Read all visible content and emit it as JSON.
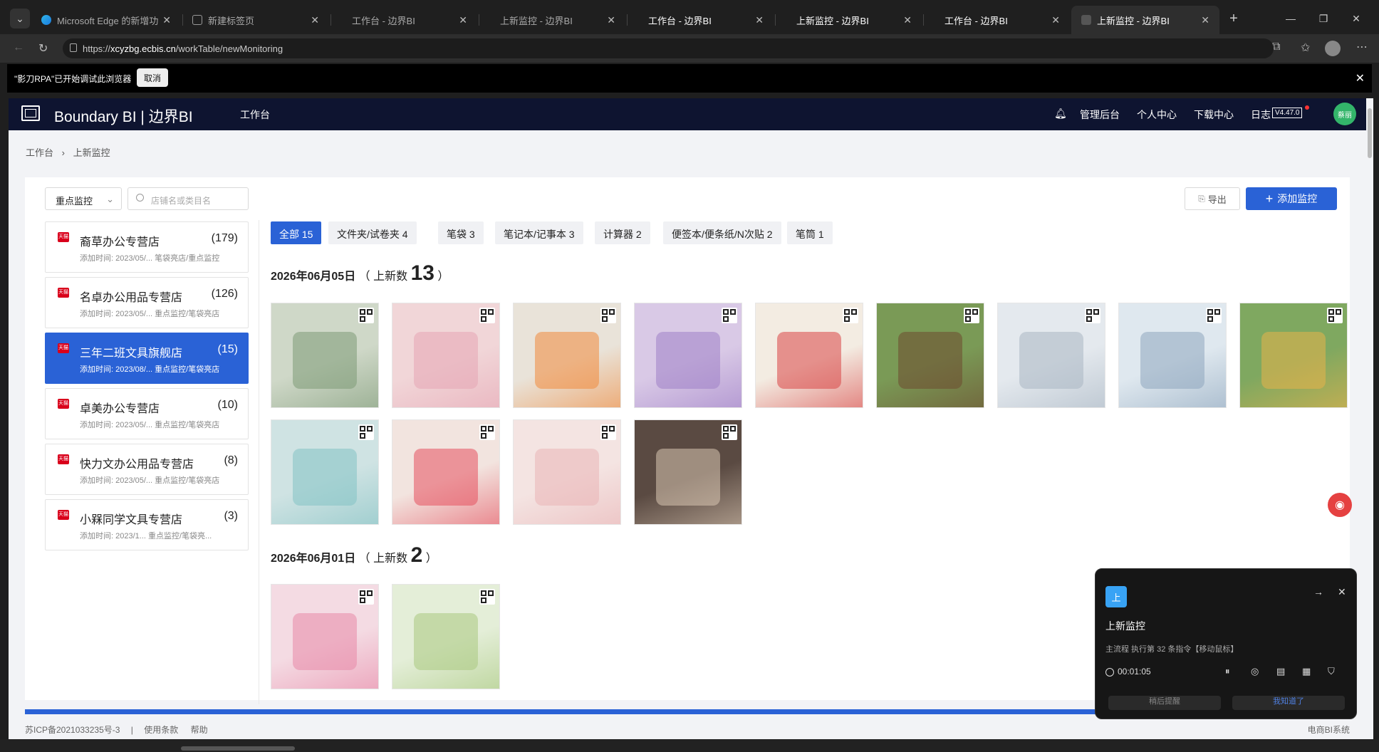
{
  "browser": {
    "tabs": [
      {
        "title": "Microsoft Edge 的新增功能",
        "icon": "edge-icon"
      },
      {
        "title": "新建标签页",
        "icon": "newtab-icon"
      },
      {
        "title": "工作台 - 边界BI",
        "icon": ""
      },
      {
        "title": "上新监控 - 边界BI",
        "icon": ""
      },
      {
        "title": "工作台 - 边界BI",
        "icon": ""
      },
      {
        "title": "上新监控 - 边界BI",
        "icon": ""
      },
      {
        "title": "工作台 - 边界BI",
        "icon": ""
      },
      {
        "title": "上新监控 - 边界BI",
        "icon": "page-icon"
      }
    ],
    "url_prefix": "https://",
    "url_host": "xcyzbg.ecbis.cn",
    "url_path": "/workTable/newMonitoring"
  },
  "rpa_bar": {
    "message": "\"影刀RPA\"已开始调试此浏览器",
    "cancel": "取消"
  },
  "app": {
    "brand": "Boundary BI | 边界BI",
    "nav_workbench": "工作台",
    "nav_admin": "管理后台",
    "nav_personal": "个人中心",
    "nav_download": "下载中心",
    "nav_log": "日志",
    "version": "V4.47.0",
    "avatar": "蔡丽"
  },
  "breadcrumb": {
    "home": "工作台",
    "current": "上新监控"
  },
  "controls": {
    "filter_value": "重点监控",
    "search_placeholder": "店铺名或类目名",
    "export": "导出",
    "add": "添加监控"
  },
  "stores": [
    {
      "name": "裔草办公专营店",
      "count": "(179)",
      "sub": "添加时间: 2023/05/... 笔袋亮店/重点监控"
    },
    {
      "name": "名卓办公用品专营店",
      "count": "(126)",
      "sub": "添加时间: 2023/05/... 重点监控/笔袋亮店"
    },
    {
      "name": "三年二班文具旗舰店",
      "count": "(15)",
      "sub": "添加时间: 2023/08/... 重点监控/笔袋亮店"
    },
    {
      "name": "卓美办公专营店",
      "count": "(10)",
      "sub": "添加时间: 2023/05/... 重点监控/笔袋亮店"
    },
    {
      "name": "快力文办公用品专营店",
      "count": "(8)",
      "sub": "添加时间: 2023/05/... 重点监控/笔袋亮店"
    },
    {
      "name": "小槑同学文具专营店",
      "count": "(3)",
      "sub": "添加时间: 2023/1... 重点监控/笔袋亮..."
    }
  ],
  "store_badge": "天猫",
  "categories": [
    "全部 15",
    "文件夹/试卷夹 4",
    "笔袋 3",
    "笔记本/记事本 3",
    "计算器 2",
    "便签本/便条纸/N次贴 2",
    "笔筒 1"
  ],
  "days": [
    {
      "date": "2026年06月05日",
      "open": "（ 上新数",
      "count": "13",
      "close": "）"
    },
    {
      "date": "2026年06月01日",
      "open": "（ 上新数",
      "count": "2",
      "close": "）"
    }
  ],
  "thumbs": [
    {
      "color": "#cfd8c8",
      "accent": "#7e9a77"
    },
    {
      "color": "#f1d6d8",
      "accent": "#e6a6b4"
    },
    {
      "color": "#e9e3d9",
      "accent": "#f08a3c"
    },
    {
      "color": "#d9c9e6",
      "accent": "#9f7fc7"
    },
    {
      "color": "#f3ece2",
      "accent": "#d94545"
    },
    {
      "color": "#7a9a56",
      "accent": "#6e4b30"
    },
    {
      "color": "#e4e9ee",
      "accent": "#a9b6c3"
    },
    {
      "color": "#dfe8ef",
      "accent": "#8ea6bd"
    },
    {
      "color": "#7fa860",
      "accent": "#e8b24a"
    },
    {
      "color": "#cfe3e3",
      "accent": "#84c2c4"
    },
    {
      "color": "#f2e4df",
      "accent": "#e5505e"
    },
    {
      "color": "#f4e4e2",
      "accent": "#e9b4b6"
    },
    {
      "color": "#5a4a42",
      "accent": "#d9c6b2"
    },
    {
      "color": "#f4dbe3",
      "accent": "#e889a8"
    },
    {
      "color": "#e4eed8",
      "accent": "#a9c97f"
    }
  ],
  "footer": {
    "icp": "苏ICP备2021033235号-3",
    "sep": "|",
    "terms": "使用条款",
    "help": "帮助",
    "system": "电商BI系统"
  },
  "rpa_panel": {
    "badge": "上",
    "title": "上新监控",
    "status": "主流程 执行第 32 条指令【移动鼠标】",
    "timer": "00:01:05",
    "under_left": "稍后提醒",
    "under_right": "我知道了"
  }
}
